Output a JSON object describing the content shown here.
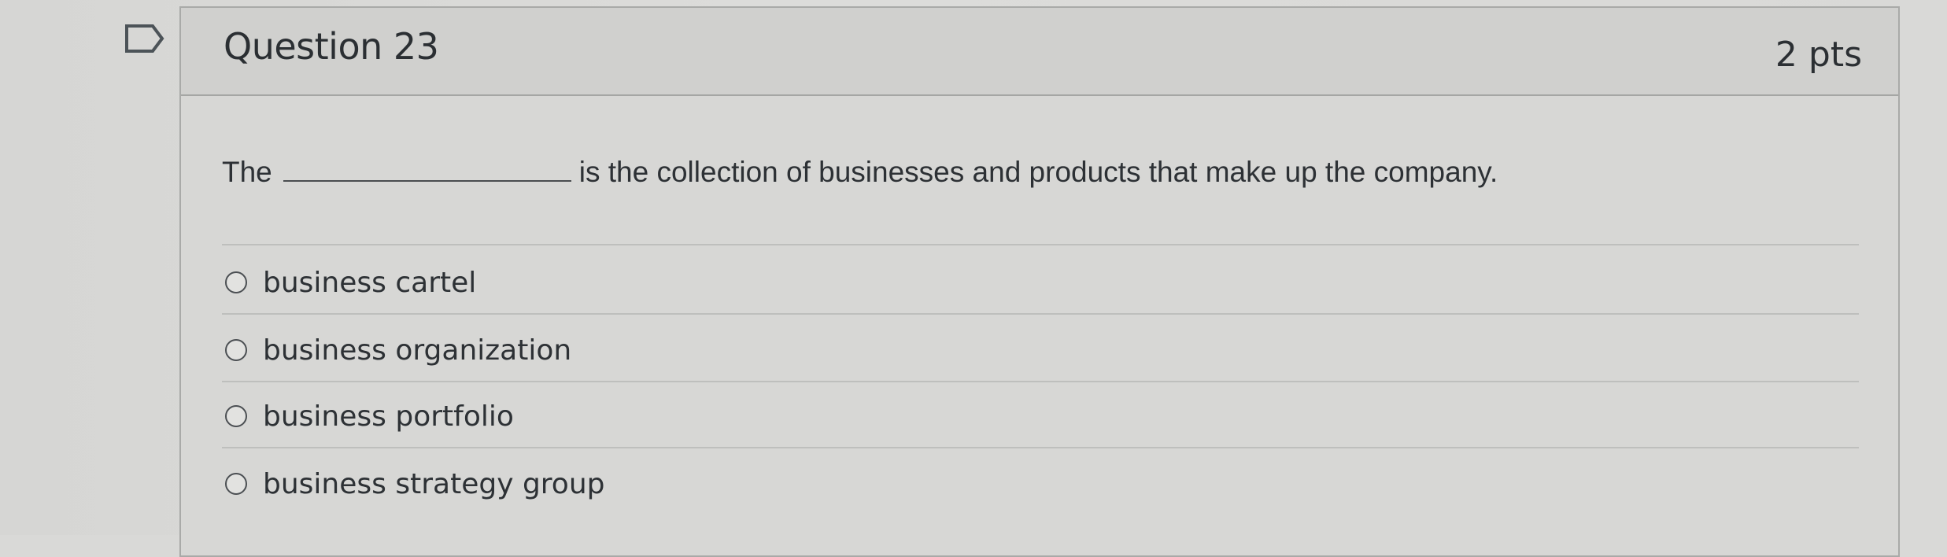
{
  "question": {
    "title": "Question 23",
    "points": "2 pts",
    "text_before": "The",
    "text_after": "is the collection of businesses and products that make up the company.",
    "flag_icon": "bookmark-flag-icon"
  },
  "answers": [
    {
      "label": "business cartel",
      "selected": false
    },
    {
      "label": "business organization",
      "selected": false
    },
    {
      "label": "business portfolio",
      "selected": false
    },
    {
      "label": "business strategy group",
      "selected": false
    }
  ]
}
